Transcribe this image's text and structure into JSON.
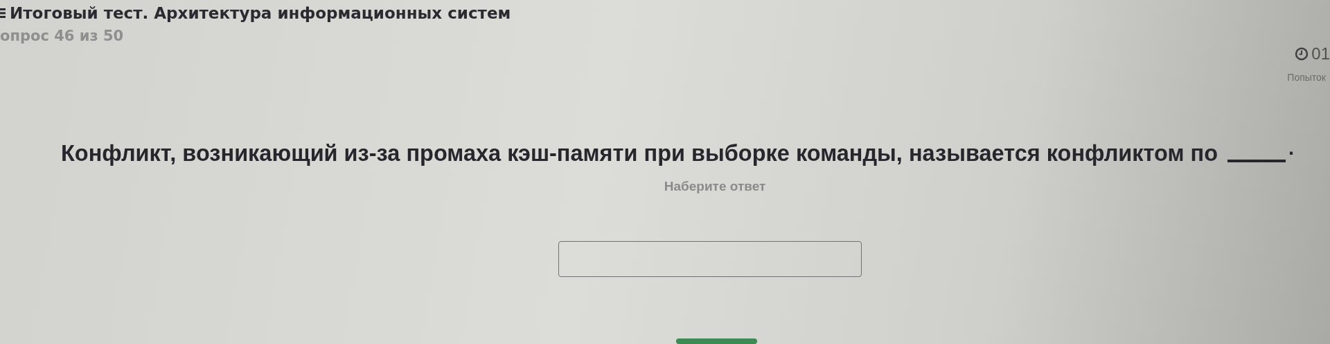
{
  "header": {
    "title": "Итоговый тест. Архитектура информационных систем",
    "progress": "опрос 46 из 50"
  },
  "timer": {
    "time": "01",
    "attempts": "Попыток"
  },
  "question": {
    "text": "Конфликт, возникающий из-за промаха кэш-памяти при выборке команды, называется конфликтом по",
    "suffix": "."
  },
  "answer": {
    "prompt": "Наберите ответ"
  }
}
